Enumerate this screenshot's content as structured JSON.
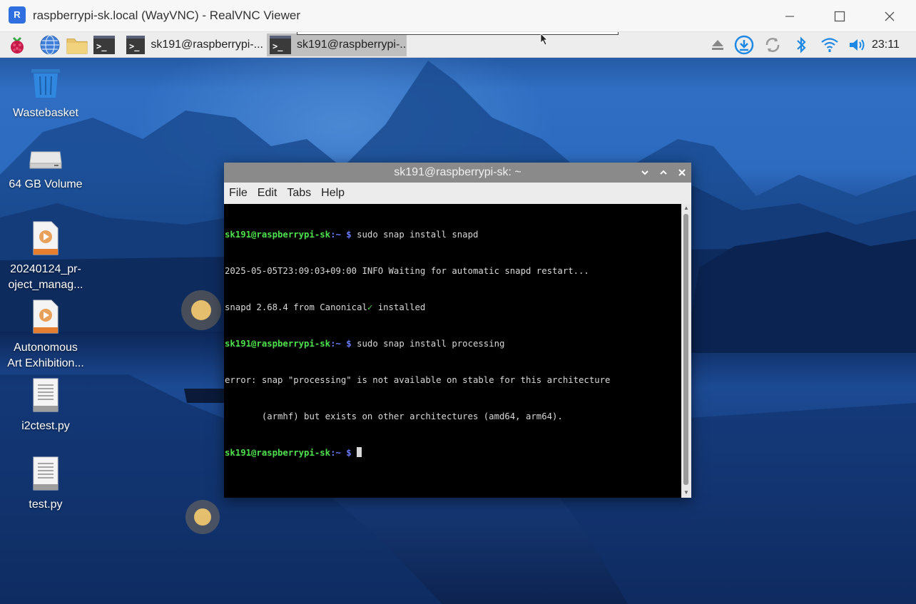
{
  "viewer": {
    "logo_text": "R",
    "title": "raspberrypi-sk.local (WayVNC) - RealVNC Viewer"
  },
  "taskbar": {
    "tasks": [
      {
        "label": "sk191@raspberrypi-..."
      },
      {
        "label": "sk191@raspberrypi-.."
      }
    ],
    "clock": "23:11",
    "accent": "#1e88e5"
  },
  "desktop": {
    "icons": [
      {
        "label": "Wastebasket",
        "icon": "trash-icon"
      },
      {
        "label": "64 GB Volume",
        "icon": "drive-icon"
      },
      {
        "label": "20240124_pr-oject_manag...",
        "line1": "20240124_pr-",
        "line2": "oject_manag...",
        "icon": "media-file-icon"
      },
      {
        "label": "Autonomous Art Exhibition...",
        "line1": "Autonomous",
        "line2": "Art Exhibition...",
        "icon": "media-file-icon"
      },
      {
        "label": "i2ctest.py",
        "icon": "text-file-icon"
      },
      {
        "label": "test.py",
        "icon": "text-file-icon"
      }
    ]
  },
  "terminal": {
    "title": "sk191@raspberrypi-sk: ~",
    "menu": [
      "File",
      "Edit",
      "Tabs",
      "Help"
    ],
    "prompt_user": "sk191@raspberrypi-sk",
    "prompt_path": ":~ $",
    "commands": {
      "cmd1": " sudo snap install snapd",
      "out1": "2025-05-05T23:09:03+09:00 INFO Waiting for automatic snapd restart...",
      "out2a": "snapd 2.68.4 from Canonical",
      "out2check": "✓",
      "out2b": " installed",
      "cmd2": " sudo snap install processing",
      "out3": "error: snap \"processing\" is not available on stable for this architecture",
      "out4": "       (armhf) but exists on other architectures (amd64, arm64).",
      "cmd3": " "
    }
  }
}
